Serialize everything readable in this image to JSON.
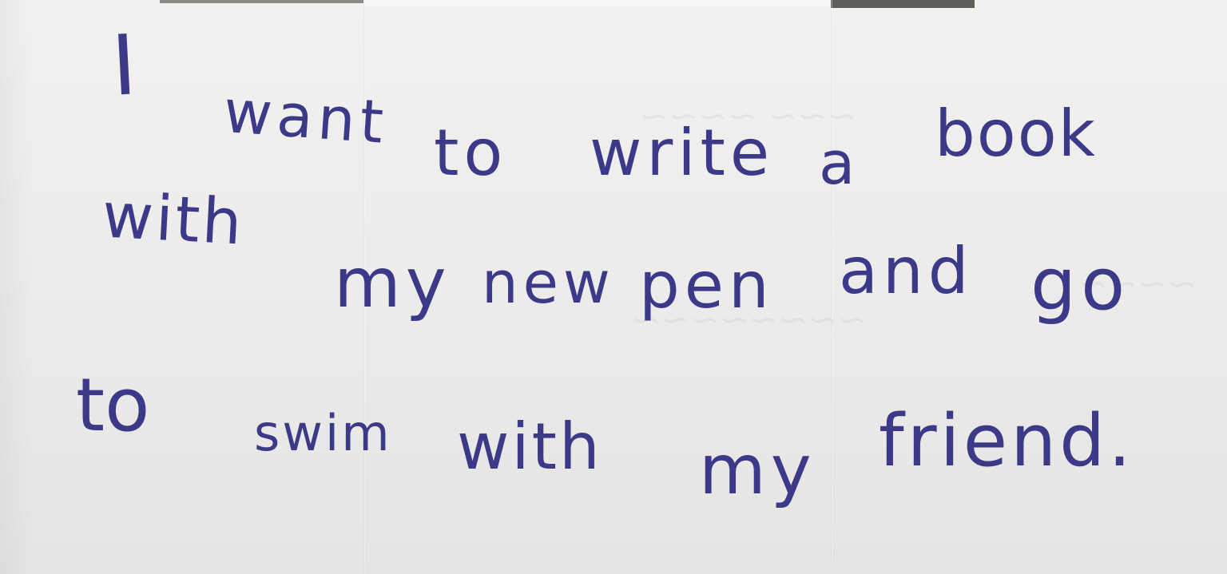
{
  "note": {
    "words": [
      {
        "text": "I"
      },
      {
        "text": "want"
      },
      {
        "text": "to"
      },
      {
        "text": "write"
      },
      {
        "text": "a"
      },
      {
        "text": "book"
      },
      {
        "text": "with"
      },
      {
        "text": "my"
      },
      {
        "text": "new"
      },
      {
        "text": "pen"
      },
      {
        "text": "and"
      },
      {
        "text": "go"
      },
      {
        "text": "to"
      },
      {
        "text": "swim"
      },
      {
        "text": "with"
      },
      {
        "text": "my"
      },
      {
        "text": "friend."
      }
    ]
  },
  "colors": {
    "ink": "#3c3a88",
    "paper": "#efefed"
  }
}
